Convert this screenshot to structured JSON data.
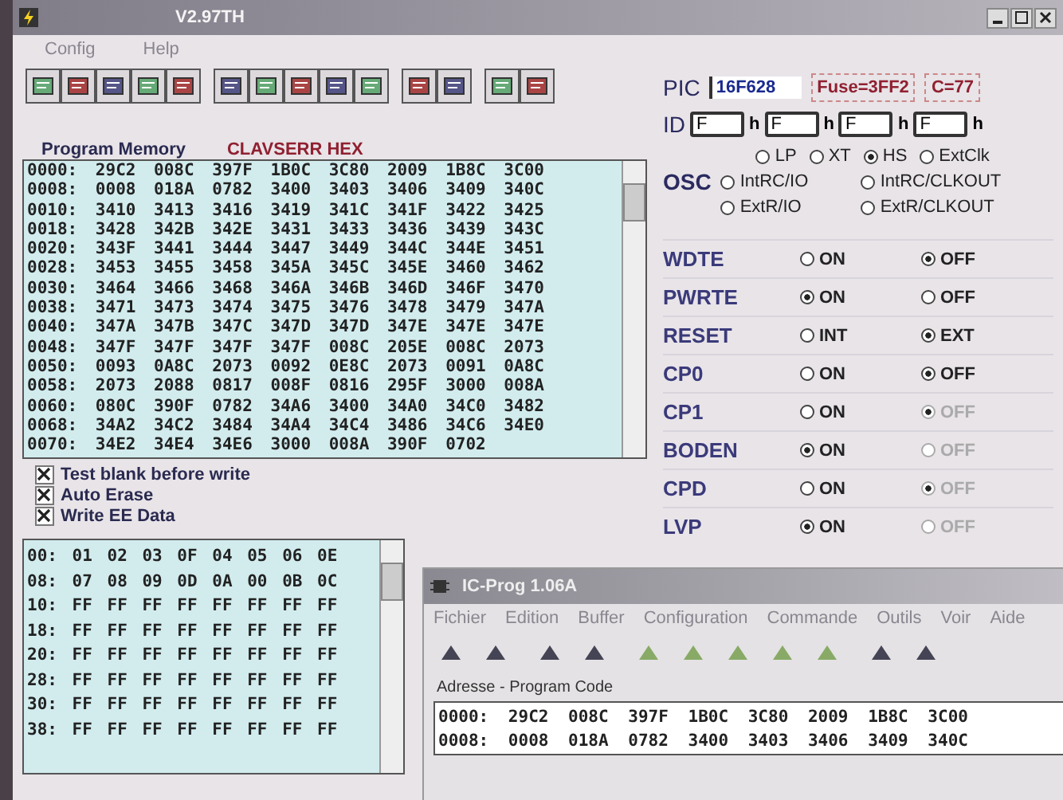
{
  "window": {
    "title": "V2.97TH",
    "menu": [
      "Config",
      "Help"
    ]
  },
  "program_memory": {
    "label": "Program Memory",
    "file": "CLAVSERR HEX",
    "rows": [
      "0000: 29C2 008C 397F 1B0C 3C80 2009 1B8C 3C00",
      "0008: 0008 018A 0782 3400 3403 3406 3409 340C",
      "0010: 3410 3413 3416 3419 341C 341F 3422 3425",
      "0018: 3428 342B 342E 3431 3433 3436 3439 343C",
      "0020: 343F 3441 3444 3447 3449 344C 344E 3451",
      "0028: 3453 3455 3458 345A 345C 345E 3460 3462",
      "0030: 3464 3466 3468 346A 346B 346D 346F 3470",
      "0038: 3471 3473 3474 3475 3476 3478 3479 347A",
      "0040: 347A 347B 347C 347D 347D 347E 347E 347E",
      "0048: 347F 347F 347F 347F 008C 205E 008C 2073",
      "0050: 0093 0A8C 2073 0092 0E8C 2073 0091 0A8C",
      "0058: 2073 2088 0817 008F 0816 295F 3000 008A",
      "0060: 080C 390F 0782 34A6 3400 34A0 34C0 3482",
      "0068: 34A2 34C2 3484 34A4 34C4 3486 34C6 34E0",
      "0070: 34E2 34E4 34E6 3000 008A 390F 0702"
    ]
  },
  "options": [
    {
      "label": "Test blank before write",
      "checked": true
    },
    {
      "label": "Auto Erase",
      "checked": true
    },
    {
      "label": "Write EE Data",
      "checked": true
    }
  ],
  "data_memory": {
    "rows": [
      "00: 01 02 03 0F 04 05 06 0E",
      "08: 07 08 09 0D 0A 00 0B 0C",
      "10: FF FF FF FF FF FF FF FF",
      "18: FF FF FF FF FF FF FF FF",
      "20: FF FF FF FF FF FF FF FF",
      "28: FF FF FF FF FF FF FF FF",
      "30: FF FF FF FF FF FF FF FF",
      "38: FF FF FF FF FF FF FF FF"
    ]
  },
  "pic": {
    "label": "PIC",
    "device": "16F628",
    "fuse": "Fuse=3FF2",
    "checksum": "C=77"
  },
  "id": {
    "label": "ID",
    "fields": [
      {
        "value": "F",
        "suffix": "h"
      },
      {
        "value": "F",
        "suffix": "h"
      },
      {
        "value": "F",
        "suffix": "h"
      },
      {
        "value": "F",
        "suffix": "h"
      }
    ]
  },
  "osc": {
    "label": "OSC",
    "options": [
      {
        "label": "LP",
        "selected": false
      },
      {
        "label": "XT",
        "selected": false
      },
      {
        "label": "HS",
        "selected": true
      },
      {
        "label": "ExtClk",
        "selected": false
      },
      {
        "label": "IntRC/IO",
        "selected": false
      },
      {
        "label": "IntRC/CLKOUT",
        "selected": false
      },
      {
        "label": "ExtR/IO",
        "selected": false
      },
      {
        "label": "ExtR/CLKOUT",
        "selected": false
      }
    ]
  },
  "fuses": [
    {
      "name": "WDTE",
      "options": [
        {
          "label": "ON",
          "selected": false,
          "disabled": false
        },
        {
          "label": "OFF",
          "selected": true,
          "disabled": false
        }
      ]
    },
    {
      "name": "PWRTE",
      "options": [
        {
          "label": "ON",
          "selected": true,
          "disabled": false
        },
        {
          "label": "OFF",
          "selected": false,
          "disabled": false
        }
      ]
    },
    {
      "name": "RESET",
      "options": [
        {
          "label": "INT",
          "selected": false,
          "disabled": false
        },
        {
          "label": "EXT",
          "selected": true,
          "disabled": false
        }
      ]
    },
    {
      "name": "CP0",
      "options": [
        {
          "label": "ON",
          "selected": false,
          "disabled": false
        },
        {
          "label": "OFF",
          "selected": true,
          "disabled": false
        }
      ]
    },
    {
      "name": "CP1",
      "options": [
        {
          "label": "ON",
          "selected": false,
          "disabled": false
        },
        {
          "label": "OFF",
          "selected": true,
          "disabled": true
        }
      ]
    },
    {
      "name": "BODEN",
      "options": [
        {
          "label": "ON",
          "selected": true,
          "disabled": false
        },
        {
          "label": "OFF",
          "selected": false,
          "disabled": true
        }
      ]
    },
    {
      "name": "CPD",
      "options": [
        {
          "label": "ON",
          "selected": false,
          "disabled": false
        },
        {
          "label": "OFF",
          "selected": true,
          "disabled": true
        }
      ]
    },
    {
      "name": "LVP",
      "options": [
        {
          "label": "ON",
          "selected": true,
          "disabled": false
        },
        {
          "label": "OFF",
          "selected": false,
          "disabled": true
        }
      ]
    }
  ],
  "second_window": {
    "title": "IC-Prog 1.06A",
    "menu": [
      "Fichier",
      "Edition",
      "Buffer",
      "Configuration",
      "Commande",
      "Outils",
      "Voir",
      "Aide"
    ],
    "section": "Adresse - Program Code",
    "rows": [
      "0000: 29C2 008C 397F 1B0C 3C80 2009 1B8C 3C00",
      "0008: 0008 018A 0782 3400 3403 3406 3409 340C"
    ]
  }
}
